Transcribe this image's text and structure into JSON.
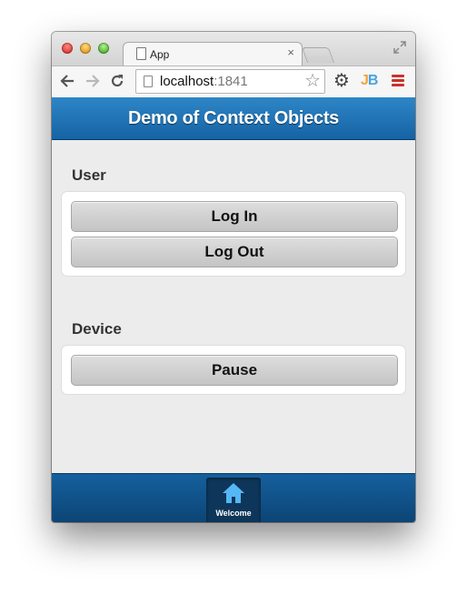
{
  "browser": {
    "tab_title": "App",
    "tab_close": "×",
    "url_host": "localhost",
    "url_port": ":1841",
    "icons": {
      "back": "arrow-left-icon",
      "forward": "arrow-right-icon",
      "reload": "reload-icon",
      "bookmark": "star-icon",
      "settings": "gear-icon",
      "extension": "jb-extension-icon",
      "menu": "hamburger-menu-icon",
      "fullscreen": "fullscreen-icon"
    }
  },
  "app": {
    "title": "Demo of Context Objects",
    "header_color": "#1e73b8",
    "sections": {
      "user": {
        "title": "User",
        "login_label": "Log In",
        "logout_label": "Log Out"
      },
      "device": {
        "title": "Device",
        "pause_label": "Pause"
      }
    },
    "footer": {
      "tab_label": "Welcome",
      "tab_icon": "home-icon",
      "icon_color": "#55b7f5"
    }
  }
}
